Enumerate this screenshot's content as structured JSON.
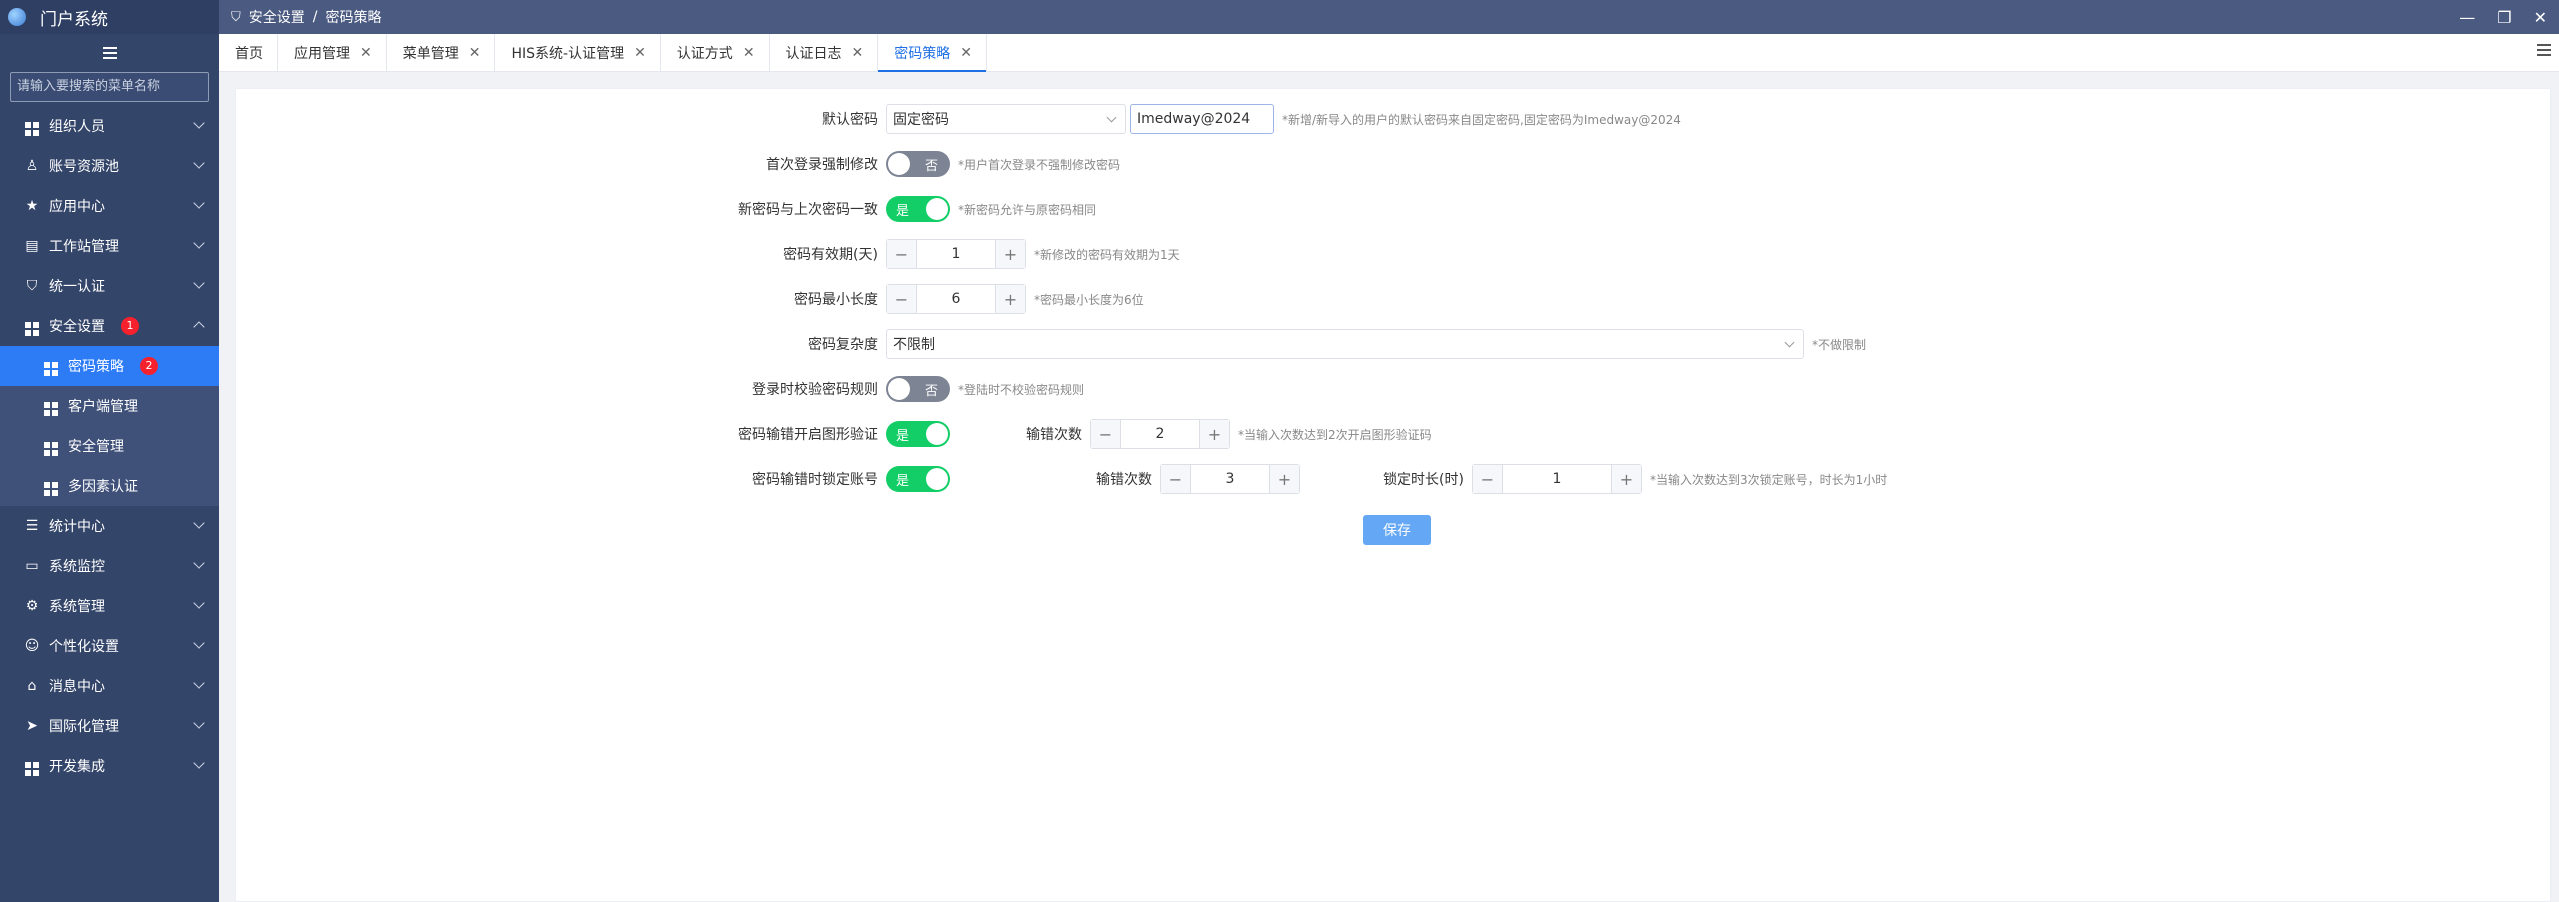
{
  "app": {
    "title": "门户系统"
  },
  "sidebar": {
    "search_placeholder": "请输入要搜索的菜单名称",
    "items": [
      {
        "label": "组织人员",
        "icon": "grid-icon"
      },
      {
        "label": "账号资源池",
        "icon": "user-icon"
      },
      {
        "label": "应用中心",
        "icon": "star-icon"
      },
      {
        "label": "工作站管理",
        "icon": "database-icon"
      },
      {
        "label": "统一认证",
        "icon": "shield-icon"
      },
      {
        "label": "安全设置",
        "icon": "grid-icon",
        "badge": "1",
        "expanded": true
      },
      {
        "label": "统计中心",
        "icon": "list-icon"
      },
      {
        "label": "系统监控",
        "icon": "monitor-icon"
      },
      {
        "label": "系统管理",
        "icon": "gear-icon"
      },
      {
        "label": "个性化设置",
        "icon": "person-icon"
      },
      {
        "label": "消息中心",
        "icon": "home-icon"
      },
      {
        "label": "国际化管理",
        "icon": "send-icon"
      },
      {
        "label": "开发集成",
        "icon": "grid-icon"
      }
    ],
    "sub_items": [
      {
        "label": "密码策略",
        "badge": "2",
        "active": true
      },
      {
        "label": "客户端管理"
      },
      {
        "label": "安全管理"
      },
      {
        "label": "多因素认证"
      }
    ]
  },
  "breadcrumb": {
    "parent": "安全设置",
    "separator": "/",
    "current": "密码策略"
  },
  "tabs": [
    {
      "label": "首页",
      "closable": false
    },
    {
      "label": "应用管理",
      "closable": true
    },
    {
      "label": "菜单管理",
      "closable": true
    },
    {
      "label": "HIS系统-认证管理",
      "closable": true
    },
    {
      "label": "认证方式",
      "closable": true
    },
    {
      "label": "认证日志",
      "closable": true
    },
    {
      "label": "密码策略",
      "closable": true,
      "active": true
    }
  ],
  "form": {
    "default_password": {
      "label": "默认密码",
      "select_value": "固定密码",
      "input_value": "Imedway@2024",
      "hint": "*新增/新导入的用户的默认密码来自固定密码,固定密码为Imedway@2024"
    },
    "first_login_force_change": {
      "label": "首次登录强制修改",
      "state": "否",
      "hint": "*用户首次登录不强制修改密码"
    },
    "same_as_last": {
      "label": "新密码与上次密码一致",
      "state": "是",
      "hint": "*新密码允许与原密码相同"
    },
    "validity_days": {
      "label": "密码有效期(天)",
      "value": "1",
      "hint": "*新修改的密码有效期为1天"
    },
    "min_length": {
      "label": "密码最小长度",
      "value": "6",
      "hint": "*密码最小长度为6位"
    },
    "complexity": {
      "label": "密码复杂度",
      "value": "不限制",
      "hint": "*不做限制"
    },
    "login_check_rule": {
      "label": "登录时校验密码规则",
      "state": "否",
      "hint": "*登陆时不校验密码规则"
    },
    "captcha_on_error": {
      "label": "密码输错开启图形验证",
      "state": "是",
      "count_label": "输错次数",
      "count_value": "2",
      "hint": "*当输入次数达到2次开启图形验证码"
    },
    "lock_on_error": {
      "label": "密码输错时锁定账号",
      "state": "是",
      "count_label": "输错次数",
      "count_value": "3",
      "duration_label": "锁定时长(时)",
      "duration_value": "1",
      "hint": "*当输入次数达到3次锁定账号，时长为1小时"
    },
    "save_label": "保存"
  },
  "stepper": {
    "minus": "−",
    "plus": "+"
  },
  "colors": {
    "sidebar_bg": "#34456a",
    "active_blue": "#2d7cf6",
    "toggle_on": "#13ce66",
    "toggle_off": "#7d8493",
    "save_button": "#64a8f5",
    "badge_red": "#f5222d"
  }
}
